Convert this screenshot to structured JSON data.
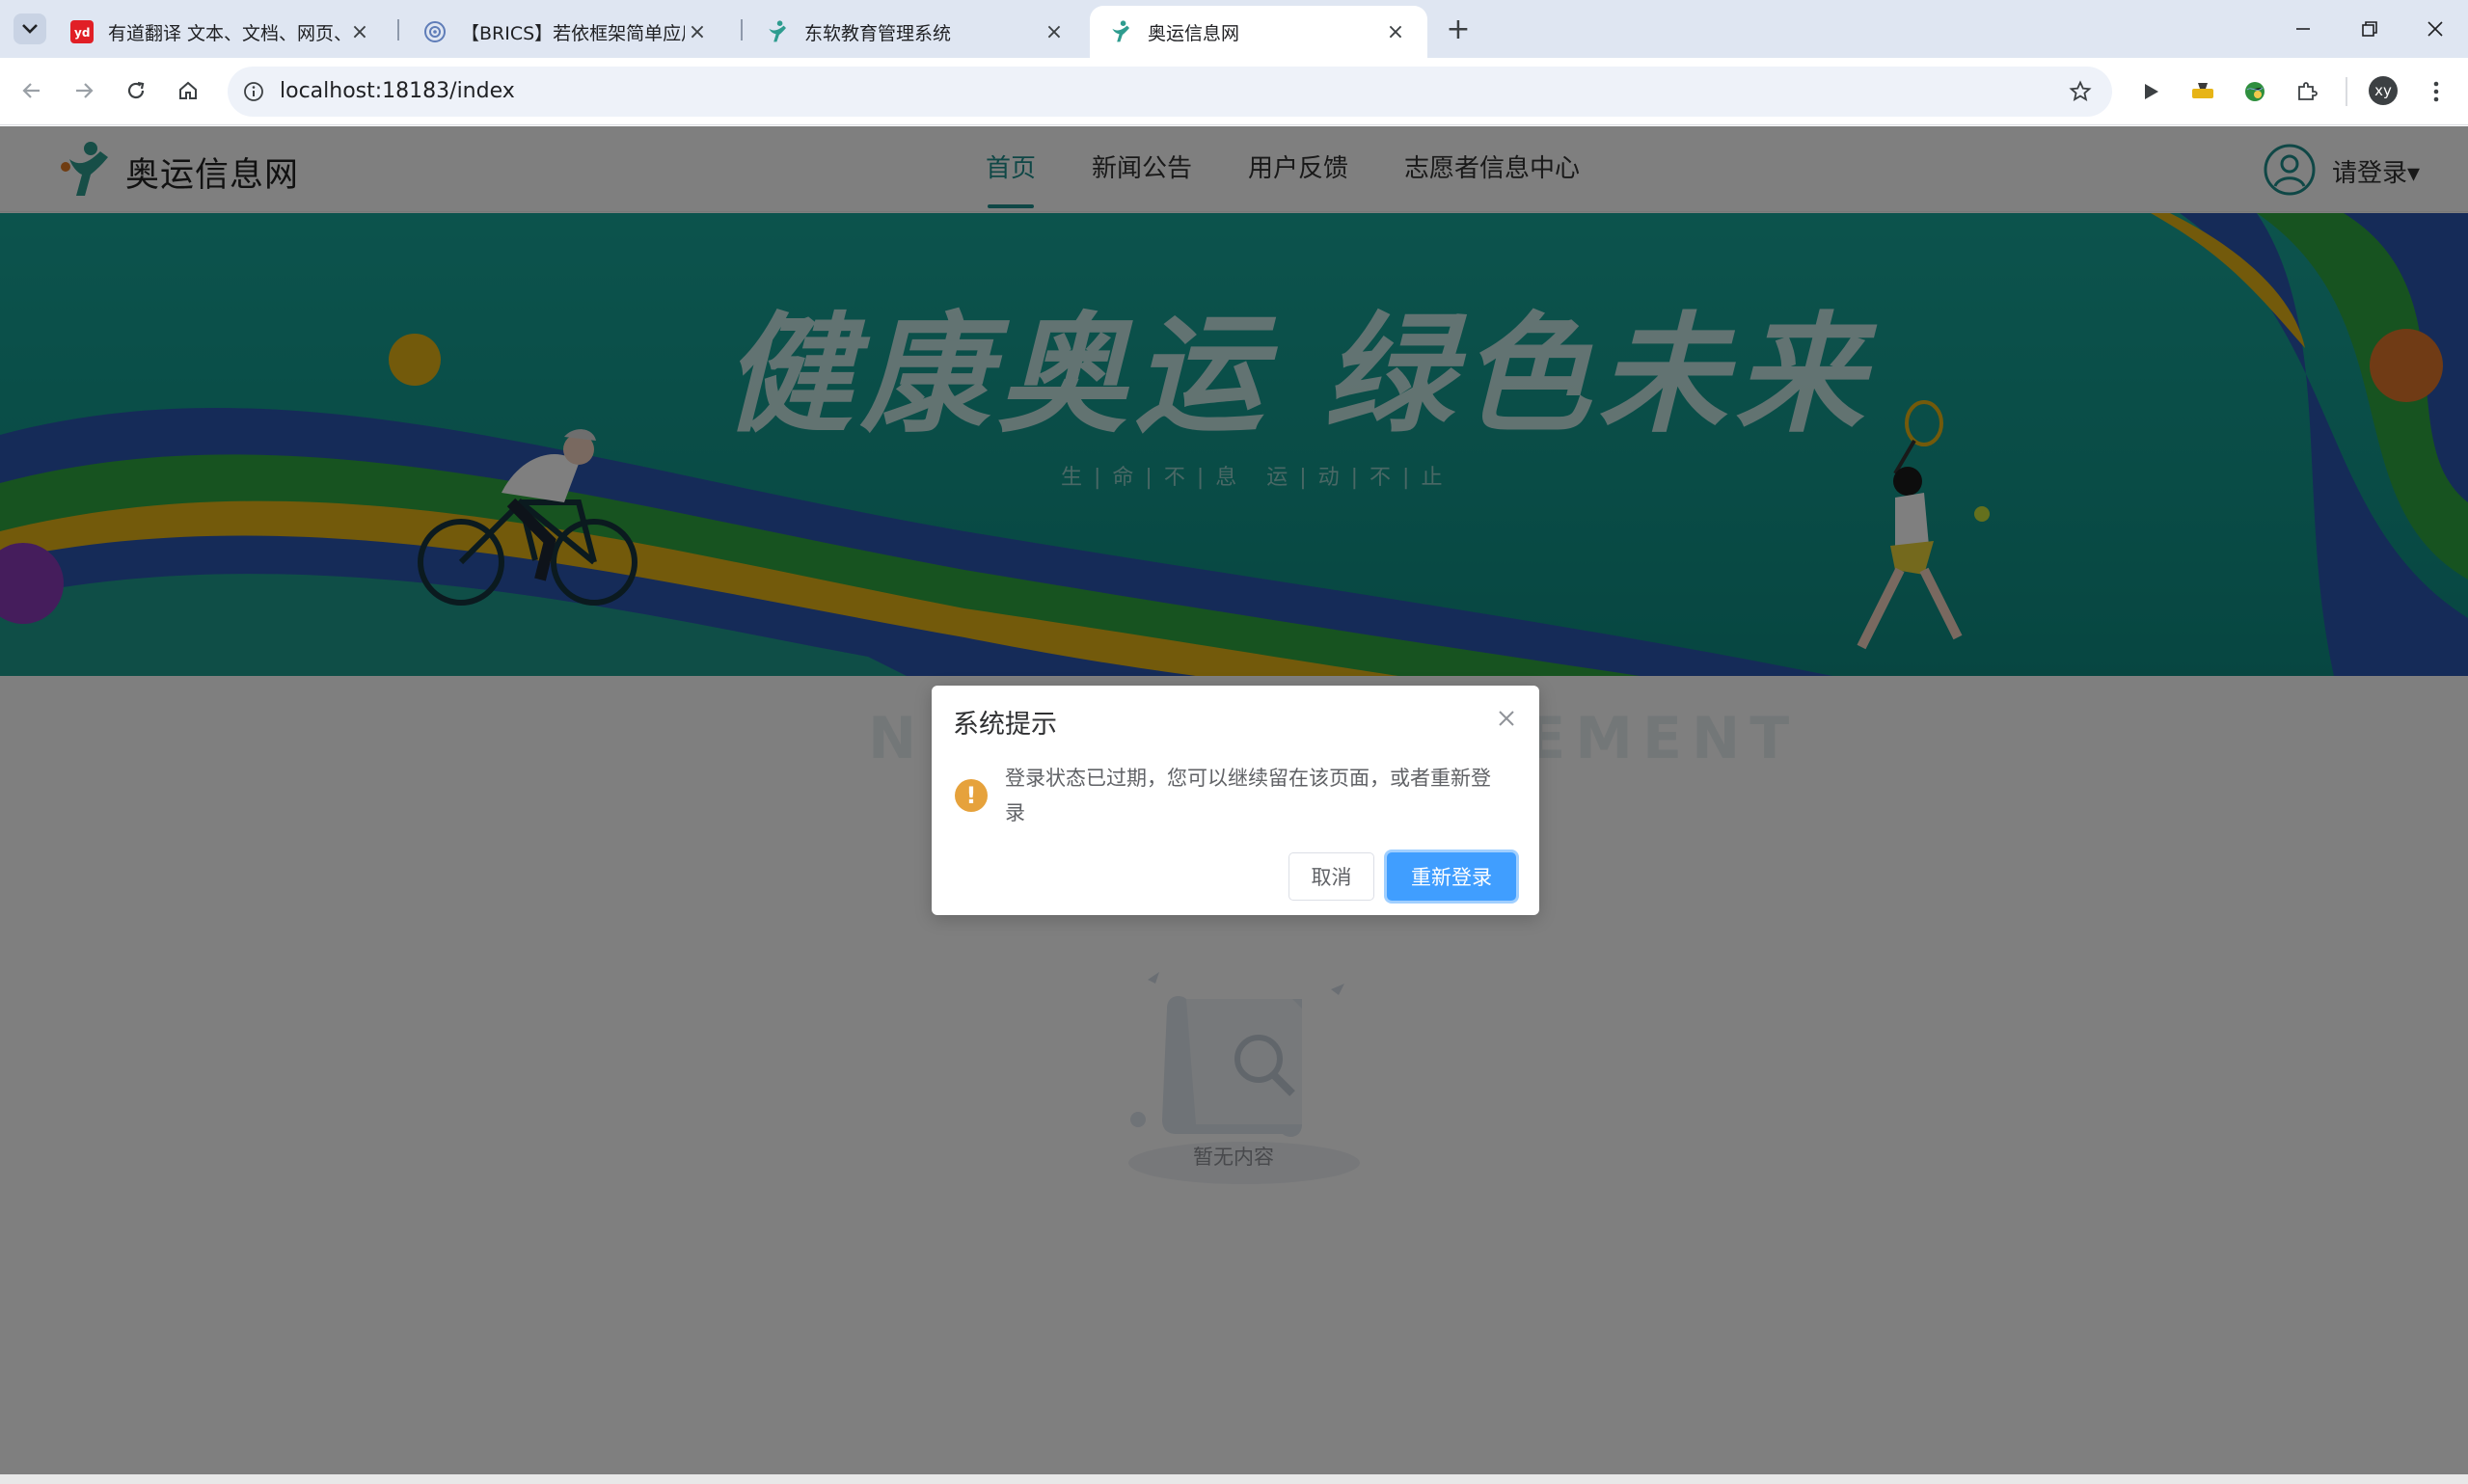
{
  "browser": {
    "tabs": [
      {
        "title": "有道翻译 文本、文档、网页、",
        "favicon": "youdao-icon"
      },
      {
        "title": "【BRICS】若依框架简单应用 |",
        "favicon": "brics-icon"
      },
      {
        "title": "东软教育管理系统",
        "favicon": "olympic-logo-icon"
      },
      {
        "title": "奥运信息网",
        "favicon": "olympic-logo-icon"
      }
    ],
    "url": "localhost:18183/index",
    "profile_initials": "xy"
  },
  "site": {
    "name": "奥运信息网",
    "nav": [
      {
        "label": "首页",
        "active": true
      },
      {
        "label": "新闻公告",
        "active": false
      },
      {
        "label": "用户反馈",
        "active": false
      },
      {
        "label": "志愿者信息中心",
        "active": false
      }
    ],
    "login_label": "请登录▾",
    "accent_color": "#1f8f8c"
  },
  "banner": {
    "headline": "健康奥运 绿色未来",
    "subline": "生|命|不|息  运|动|不|止"
  },
  "content": {
    "section_bg_title": "NEWS ANNOUNCEMENT",
    "empty_text": "暂无内容"
  },
  "dialog": {
    "title": "系统提示",
    "message": "登录状态已过期，您可以继续留在该页面，或者重新登录",
    "cancel_label": "取消",
    "confirm_label": "重新登录",
    "icon": "warning-icon"
  }
}
